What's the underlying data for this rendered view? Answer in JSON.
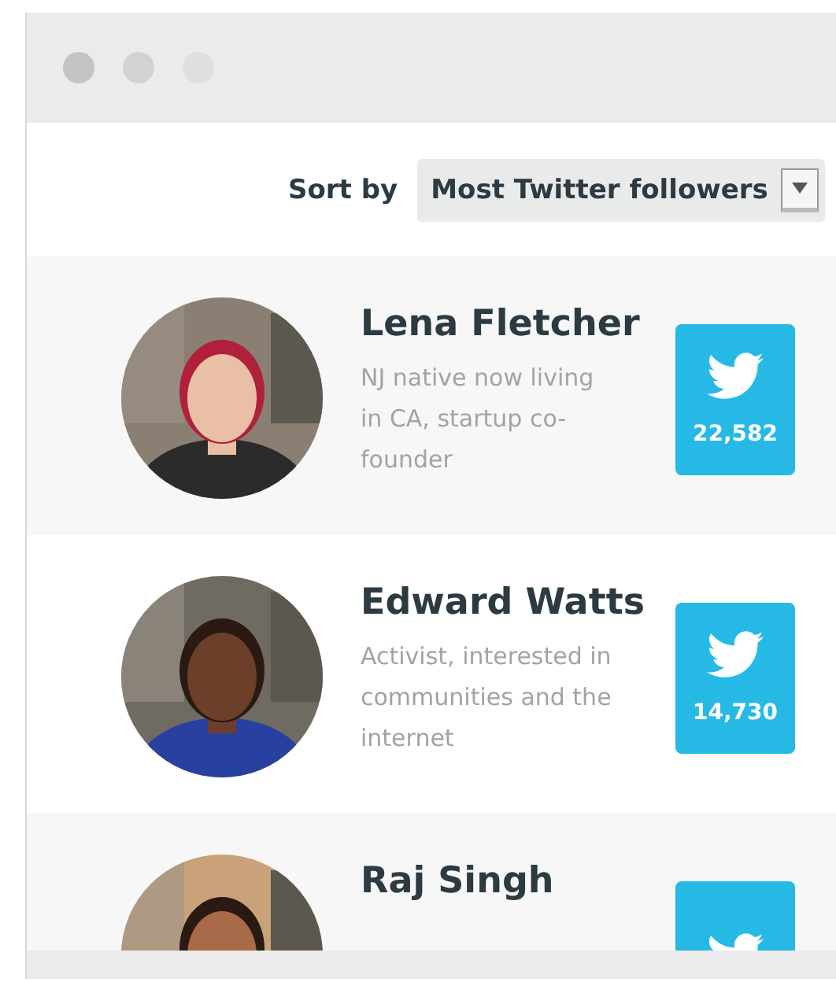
{
  "sort": {
    "label": "Sort by",
    "value": "Most Twitter followers"
  },
  "people": [
    {
      "name": "Lena Fletcher",
      "bio": "NJ native now living in CA, startup co-founder",
      "followers": "22,582"
    },
    {
      "name": "Edward Watts",
      "bio": "Activist, interested in communities and the internet",
      "followers": "14,730"
    },
    {
      "name": "Raj Singh"
    }
  ]
}
